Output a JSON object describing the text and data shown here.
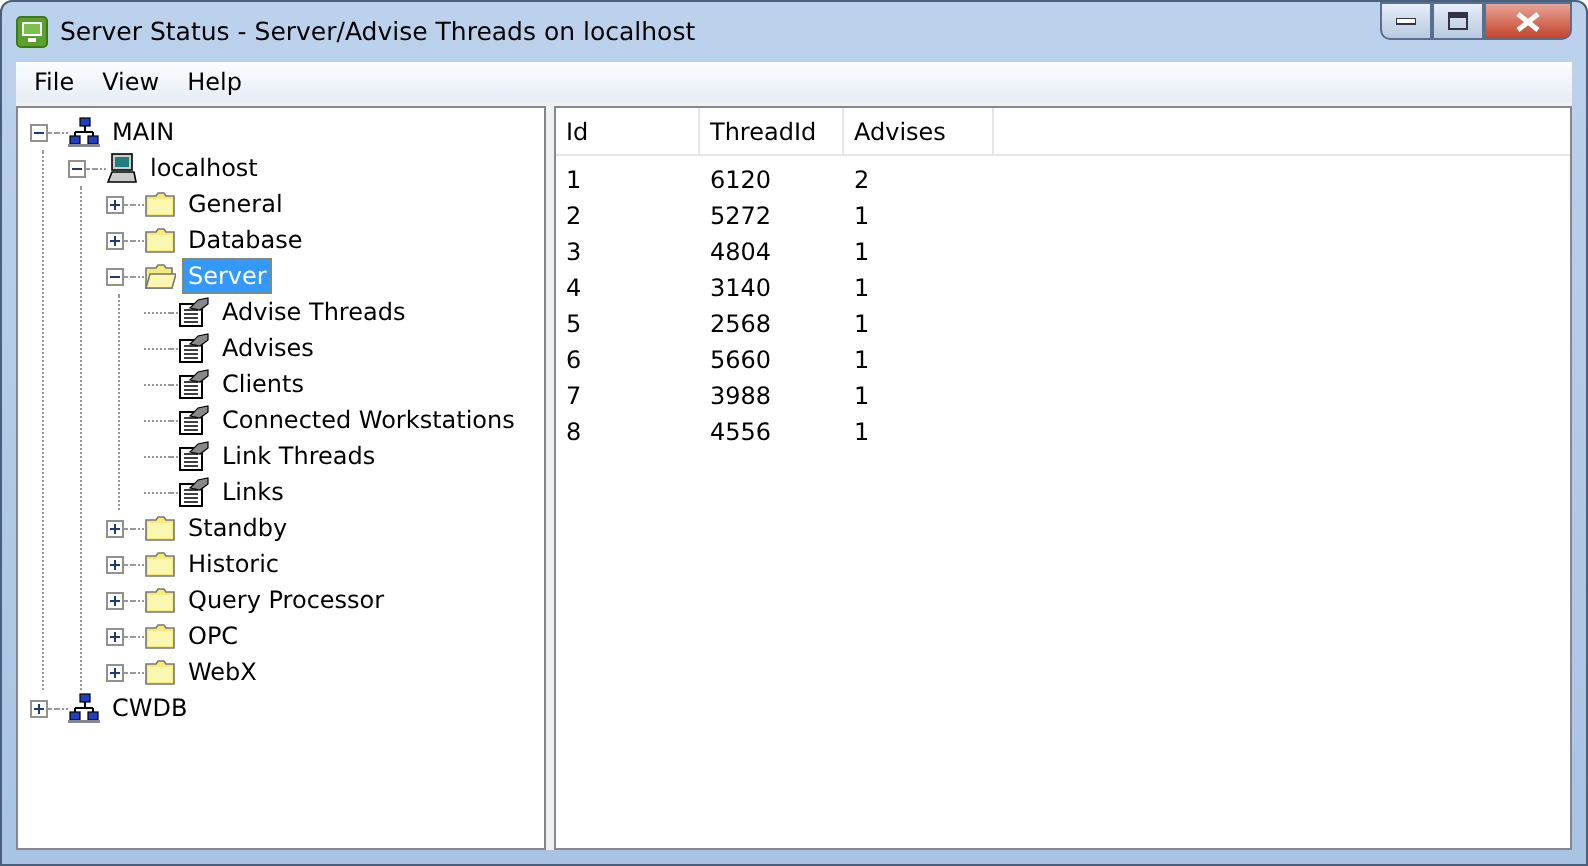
{
  "window": {
    "title": "Server Status - Server/Advise Threads on localhost"
  },
  "menu": [
    "File",
    "View",
    "Help"
  ],
  "tree": [
    {
      "label": "MAIN",
      "kind": "network",
      "expanded": true,
      "selected": false,
      "children": [
        {
          "label": "localhost",
          "kind": "computer",
          "expanded": true,
          "selected": false,
          "children": [
            {
              "label": "General",
              "kind": "folder",
              "expanded": false,
              "selected": false
            },
            {
              "label": "Database",
              "kind": "folder",
              "expanded": false,
              "selected": false
            },
            {
              "label": "Server",
              "kind": "folder",
              "expanded": true,
              "selected": true,
              "children": [
                {
                  "label": "Advise Threads",
                  "kind": "document",
                  "selected": false
                },
                {
                  "label": "Advises",
                  "kind": "document",
                  "selected": false
                },
                {
                  "label": "Clients",
                  "kind": "document",
                  "selected": false
                },
                {
                  "label": "Connected Workstations",
                  "kind": "document",
                  "selected": false
                },
                {
                  "label": "Link Threads",
                  "kind": "document",
                  "selected": false
                },
                {
                  "label": "Links",
                  "kind": "document",
                  "selected": false
                }
              ]
            },
            {
              "label": "Standby",
              "kind": "folder",
              "expanded": false,
              "selected": false
            },
            {
              "label": "Historic",
              "kind": "folder",
              "expanded": false,
              "selected": false
            },
            {
              "label": "Query Processor",
              "kind": "folder",
              "expanded": false,
              "selected": false
            },
            {
              "label": "OPC",
              "kind": "folder",
              "expanded": false,
              "selected": false
            },
            {
              "label": "WebX",
              "kind": "folder",
              "expanded": false,
              "selected": false
            }
          ]
        }
      ]
    },
    {
      "label": "CWDB",
      "kind": "network",
      "expanded": false,
      "selected": false
    }
  ],
  "table": {
    "columns": [
      "Id",
      "ThreadId",
      "Advises"
    ],
    "rows": [
      [
        "1",
        "6120",
        "2"
      ],
      [
        "2",
        "5272",
        "1"
      ],
      [
        "3",
        "4804",
        "1"
      ],
      [
        "4",
        "3140",
        "1"
      ],
      [
        "5",
        "2568",
        "1"
      ],
      [
        "6",
        "5660",
        "1"
      ],
      [
        "7",
        "3988",
        "1"
      ],
      [
        "8",
        "4556",
        "1"
      ]
    ]
  }
}
